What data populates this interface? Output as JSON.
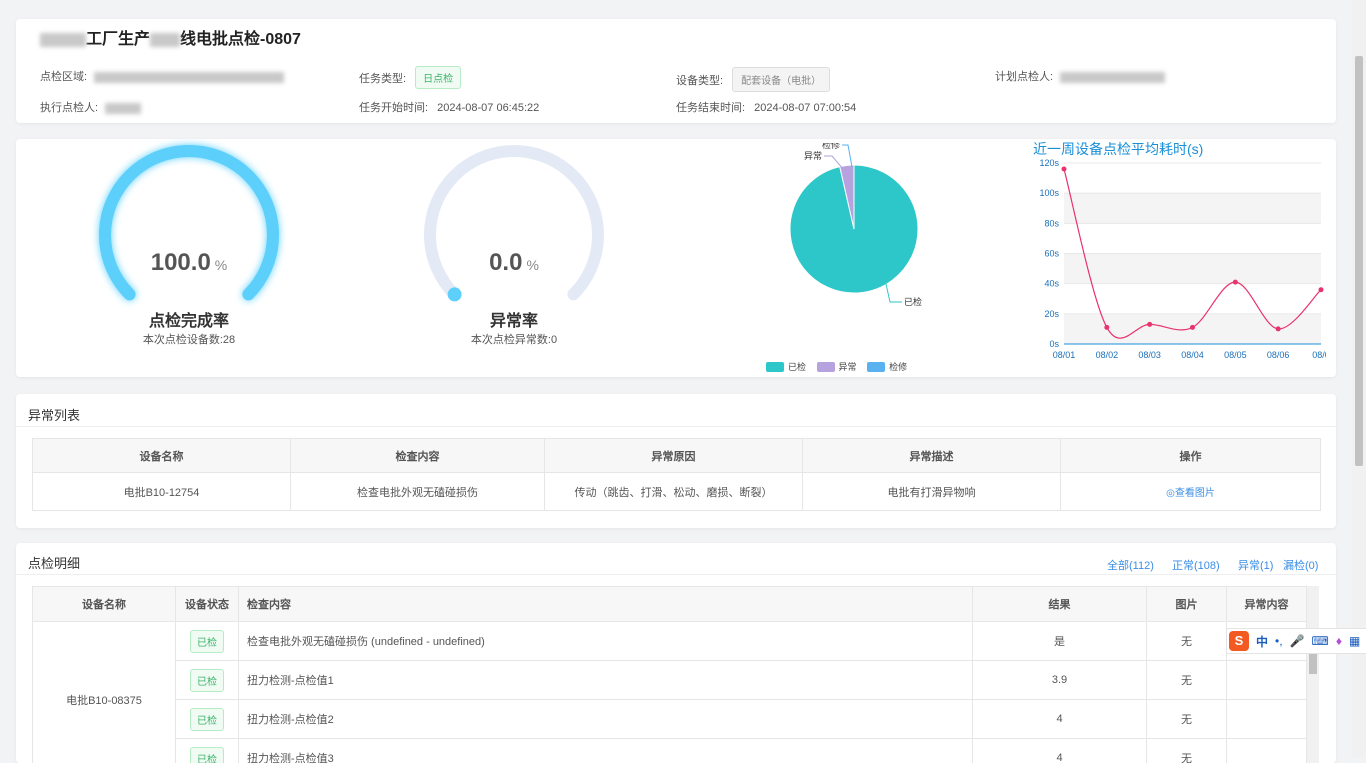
{
  "header": {
    "title_visible": "工厂生产",
    "title_suffix": "线电批点检-0807",
    "fields": {
      "area_label": "点检区域:",
      "task_type_label": "任务类型:",
      "task_type_value": "日点检",
      "device_type_label": "设备类型:",
      "device_type_value": "配套设备（电批）",
      "planner_label": "计划点检人:",
      "executor_label": "执行点检人:",
      "start_label": "任务开始时间:",
      "start_value": "2024-08-07 06:45:22",
      "end_label": "任务结束时间:",
      "end_value": "2024-08-07 07:00:54"
    }
  },
  "gauges": [
    {
      "value": "100.0",
      "unit": "%",
      "label": "点检完成率",
      "sub": "本次点检设备数:28",
      "fraction": 1.0,
      "color": "#5cd0fb",
      "track": "#e4eaf5"
    },
    {
      "value": "0.0",
      "unit": "%",
      "label": "异常率",
      "sub": "本次点检异常数:0",
      "fraction": 0.0,
      "color": "#5cd0fb",
      "track": "#e4eaf5"
    }
  ],
  "chart_data": [
    {
      "type": "pie",
      "categories": [
        "已检",
        "异常",
        "检修"
      ],
      "values": [
        27,
        1,
        0
      ],
      "colors": [
        "#2ec7c9",
        "#b6a2de",
        "#5ab1ef"
      ],
      "legend": [
        "已检",
        "异常",
        "检修"
      ],
      "legend_position": "bottom"
    },
    {
      "type": "line",
      "title": "近一周设备点检平均耗时(s)",
      "x": [
        "08/01",
        "08/02",
        "08/03",
        "08/04",
        "08/05",
        "08/06",
        "08/0"
      ],
      "series": [
        {
          "values": [
            116,
            11,
            13,
            11,
            41,
            10,
            36
          ]
        }
      ],
      "yticks": [
        "0s",
        "20s",
        "40s",
        "60s",
        "80s",
        "100s",
        "120s"
      ],
      "ylim": [
        0,
        120
      ],
      "grid": true,
      "color": "#e8336d"
    }
  ],
  "abnormal": {
    "title": "异常列表",
    "headers": [
      "设备名称",
      "检查内容",
      "异常原因",
      "异常描述",
      "操作"
    ],
    "rows": [
      [
        "电批B10-12754",
        "检查电批外观无磕碰损伤",
        "传动（跳齿、打滑、松动、磨损、断裂）",
        "电批有打滑异物响",
        "查看图片"
      ]
    ]
  },
  "detail": {
    "title": "点检明细",
    "filters": [
      "全部(112)",
      "正常(108)",
      "异常(1)",
      "漏检(0)"
    ],
    "headers": [
      "设备名称",
      "设备状态",
      "检查内容",
      "结果",
      "图片",
      "异常内容"
    ],
    "device": "电批B10-08375",
    "rows": [
      {
        "status": "已检",
        "content": "检查电批外观无磕碰损伤 (undefined - undefined)",
        "result": "是",
        "image": "无"
      },
      {
        "status": "已检",
        "content": "扭力检测-点检值1",
        "result": "3.9",
        "image": "无"
      },
      {
        "status": "已检",
        "content": "扭力检测-点检值2",
        "result": "4",
        "image": "无"
      },
      {
        "status": "已检",
        "content": "扭力检测-点检值3",
        "result": "4",
        "image": "无"
      }
    ]
  },
  "ime": {
    "label_zh": "中"
  }
}
